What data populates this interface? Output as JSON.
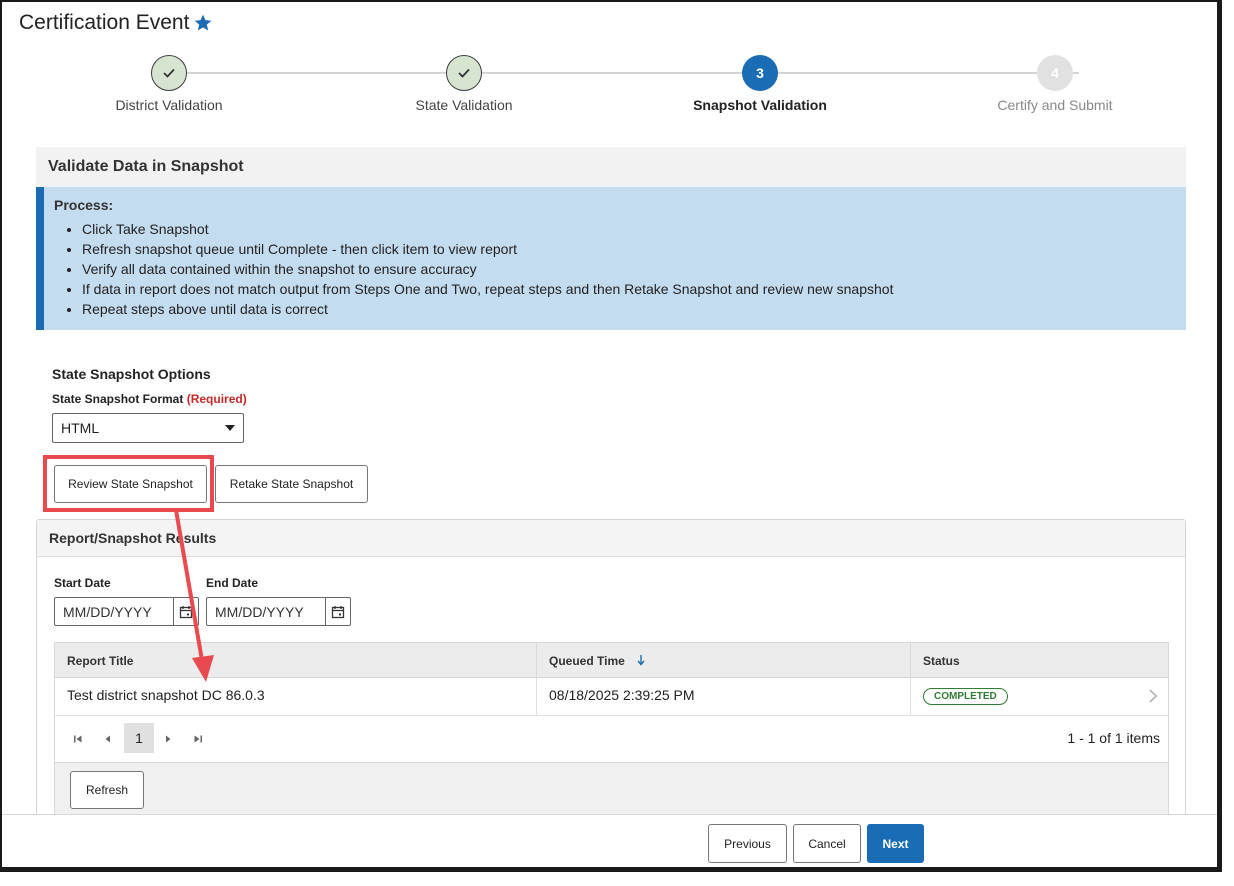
{
  "header": {
    "title": "Certification Event"
  },
  "stepper": {
    "steps": [
      {
        "label": "District Validation",
        "state": "done"
      },
      {
        "label": "State Validation",
        "state": "done"
      },
      {
        "label": "Snapshot Validation",
        "state": "active",
        "number": "3"
      },
      {
        "label": "Certify and Submit",
        "state": "todo",
        "number": "4"
      }
    ]
  },
  "section": {
    "title": "Validate Data in Snapshot"
  },
  "process": {
    "title": "Process:",
    "items": [
      "Click Take Snapshot",
      "Refresh snapshot queue until Complete - then click item to view report",
      "Verify all data contained within the snapshot to ensure accuracy",
      "If data in report does not match output from Steps One and Two, repeat steps and then Retake Snapshot and review new snapshot",
      "Repeat steps above until data is correct"
    ]
  },
  "options": {
    "title": "State Snapshot Options",
    "format_label": "State Snapshot Format",
    "required_label": "(Required)",
    "format_value": "HTML",
    "review_button": "Review State Snapshot",
    "retake_button": "Retake State Snapshot"
  },
  "results": {
    "title": "Report/Snapshot Results",
    "start_date_label": "Start Date",
    "end_date_label": "End Date",
    "start_date_placeholder": "MM/DD/YYYY",
    "end_date_placeholder": "MM/DD/YYYY",
    "columns": [
      "Report Title",
      "Queued Time",
      "Status"
    ],
    "rows": [
      {
        "title": "Test district snapshot DC 86.0.3",
        "queued": "08/18/2025 2:39:25 PM",
        "status": "COMPLETED"
      }
    ],
    "page": "1",
    "count_text": "1 - 1 of 1 items",
    "refresh_button": "Refresh"
  },
  "footer": {
    "previous": "Previous",
    "cancel": "Cancel",
    "next": "Next"
  },
  "colors": {
    "accent": "#1a6cb5",
    "highlight": "#e84a4f",
    "success": "#2e7d32",
    "info_bg": "#c4dcf0"
  }
}
